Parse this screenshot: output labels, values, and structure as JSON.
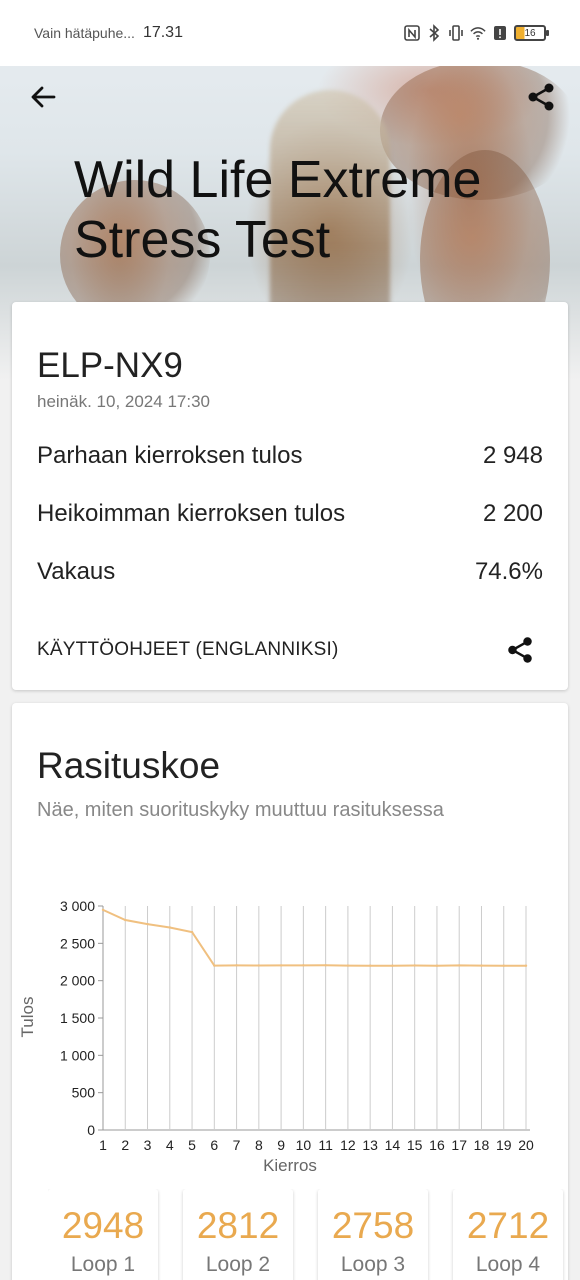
{
  "status_bar": {
    "carrier": "Vain hätäpuhe...",
    "time": "17.31",
    "battery": "16"
  },
  "header": {
    "title": "Wild Life Extreme Stress Test"
  },
  "summary": {
    "device": "ELP-NX9",
    "date": "heinäk. 10, 2024 17:30",
    "best_label": "Parhaan kierroksen tulos",
    "best_value": "2 948",
    "worst_label": "Heikoimman kierroksen tulos",
    "worst_value": "2 200",
    "stability_label": "Vakaus",
    "stability_value": "74.6%",
    "instructions": "KÄYTTÖOHJEET (ENGLANNIKSI)"
  },
  "stress": {
    "title": "Rasituskoe",
    "subtitle": "Näe, miten suorituskyky muuttuu rasituksessa"
  },
  "chart_data": {
    "type": "line",
    "xlabel": "Kierros",
    "ylabel": "Tulos",
    "x": [
      1,
      2,
      3,
      4,
      5,
      6,
      7,
      8,
      9,
      10,
      11,
      12,
      13,
      14,
      15,
      16,
      17,
      18,
      19,
      20
    ],
    "values": [
      2948,
      2812,
      2758,
      2712,
      2650,
      2202,
      2205,
      2203,
      2204,
      2205,
      2206,
      2202,
      2201,
      2200,
      2203,
      2200,
      2204,
      2202,
      2200,
      2200
    ],
    "ylim": [
      0,
      3000
    ],
    "yticks": [
      "0",
      "500",
      "1 000",
      "1 500",
      "2 000",
      "2 500",
      "3 000"
    ],
    "ytick_values": [
      0,
      500,
      1000,
      1500,
      2000,
      2500,
      3000
    ],
    "grid": "vertical",
    "line_color": "#f0c080"
  },
  "loops": [
    {
      "value": "2948",
      "label": "Loop 1"
    },
    {
      "value": "2812",
      "label": "Loop 2"
    },
    {
      "value": "2758",
      "label": "Loop 3"
    },
    {
      "value": "2712",
      "label": "Loop 4"
    }
  ],
  "icons": {
    "back": "arrow-left-icon",
    "share": "share-icon"
  },
  "colors": {
    "accent": "#e9a94f",
    "chart_line": "#f0c080"
  }
}
